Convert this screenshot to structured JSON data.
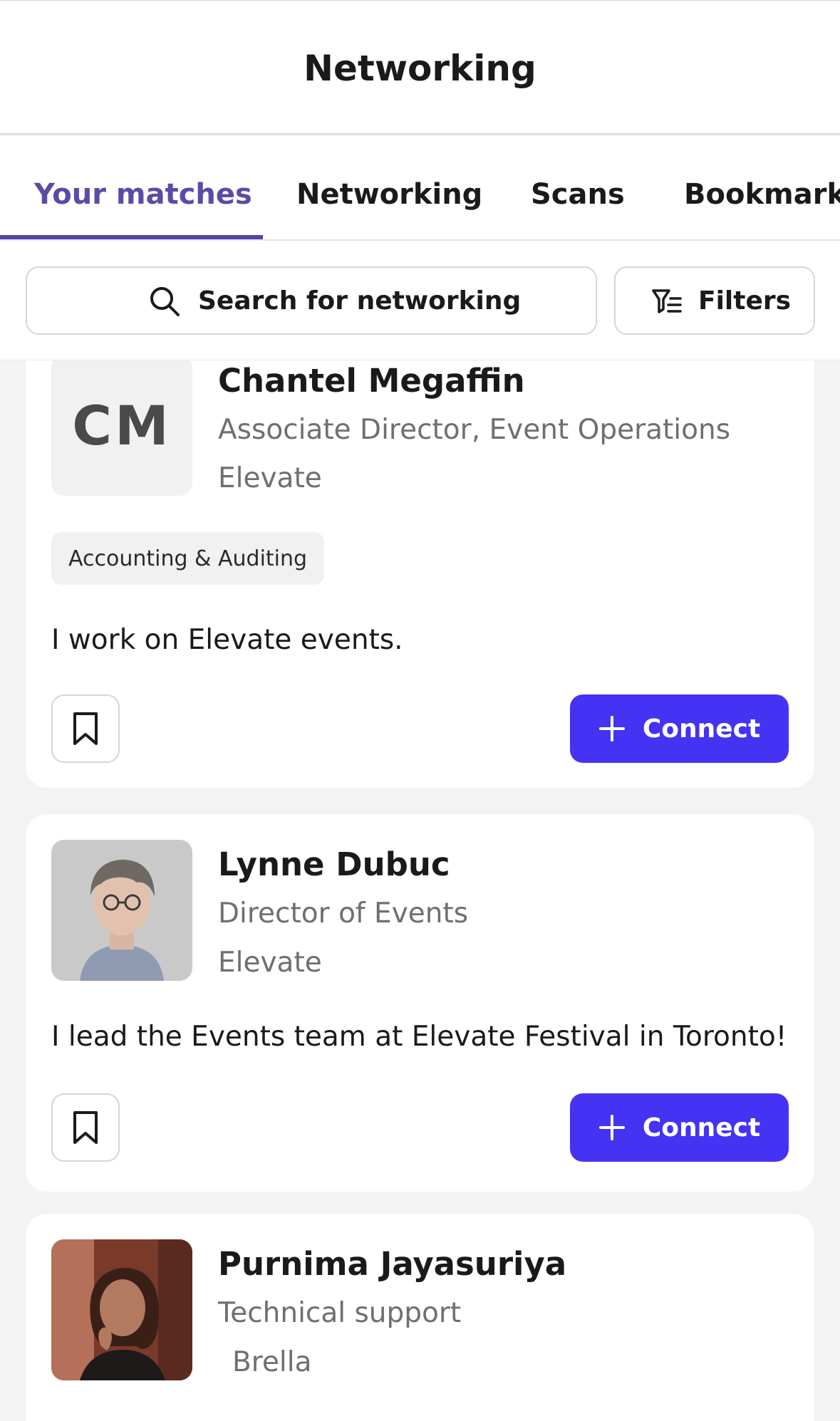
{
  "header": {
    "title": "Networking"
  },
  "tabs": [
    {
      "label": "Your matches",
      "active": true
    },
    {
      "label": "Networking",
      "active": false
    },
    {
      "label": "Scans",
      "active": false
    },
    {
      "label": "Bookmarks",
      "active": false
    }
  ],
  "search": {
    "label": "Search for networking",
    "icon": "search-icon"
  },
  "filters": {
    "label": "Filters",
    "icon": "filter-icon"
  },
  "colors": {
    "accent": "#5546a8",
    "connect": "#4433f2",
    "list_bg": "#f3f3f4"
  },
  "people": [
    {
      "initials": "CM",
      "name": "Chantel Megaffin",
      "title": "Associate Director, Event Operations",
      "company": "Elevate",
      "tag": "Accounting & Auditing",
      "about": "I work on Elevate events.",
      "connect_label": "Connect"
    },
    {
      "name": "Lynne Dubuc",
      "title": "Director of Events",
      "company": "Elevate",
      "about": "I lead the Events team at Elevate Festival in Toronto!",
      "connect_label": "Connect"
    },
    {
      "name": "Purnima Jayasuriya",
      "title": "Technical support",
      "company": "Brella"
    }
  ]
}
